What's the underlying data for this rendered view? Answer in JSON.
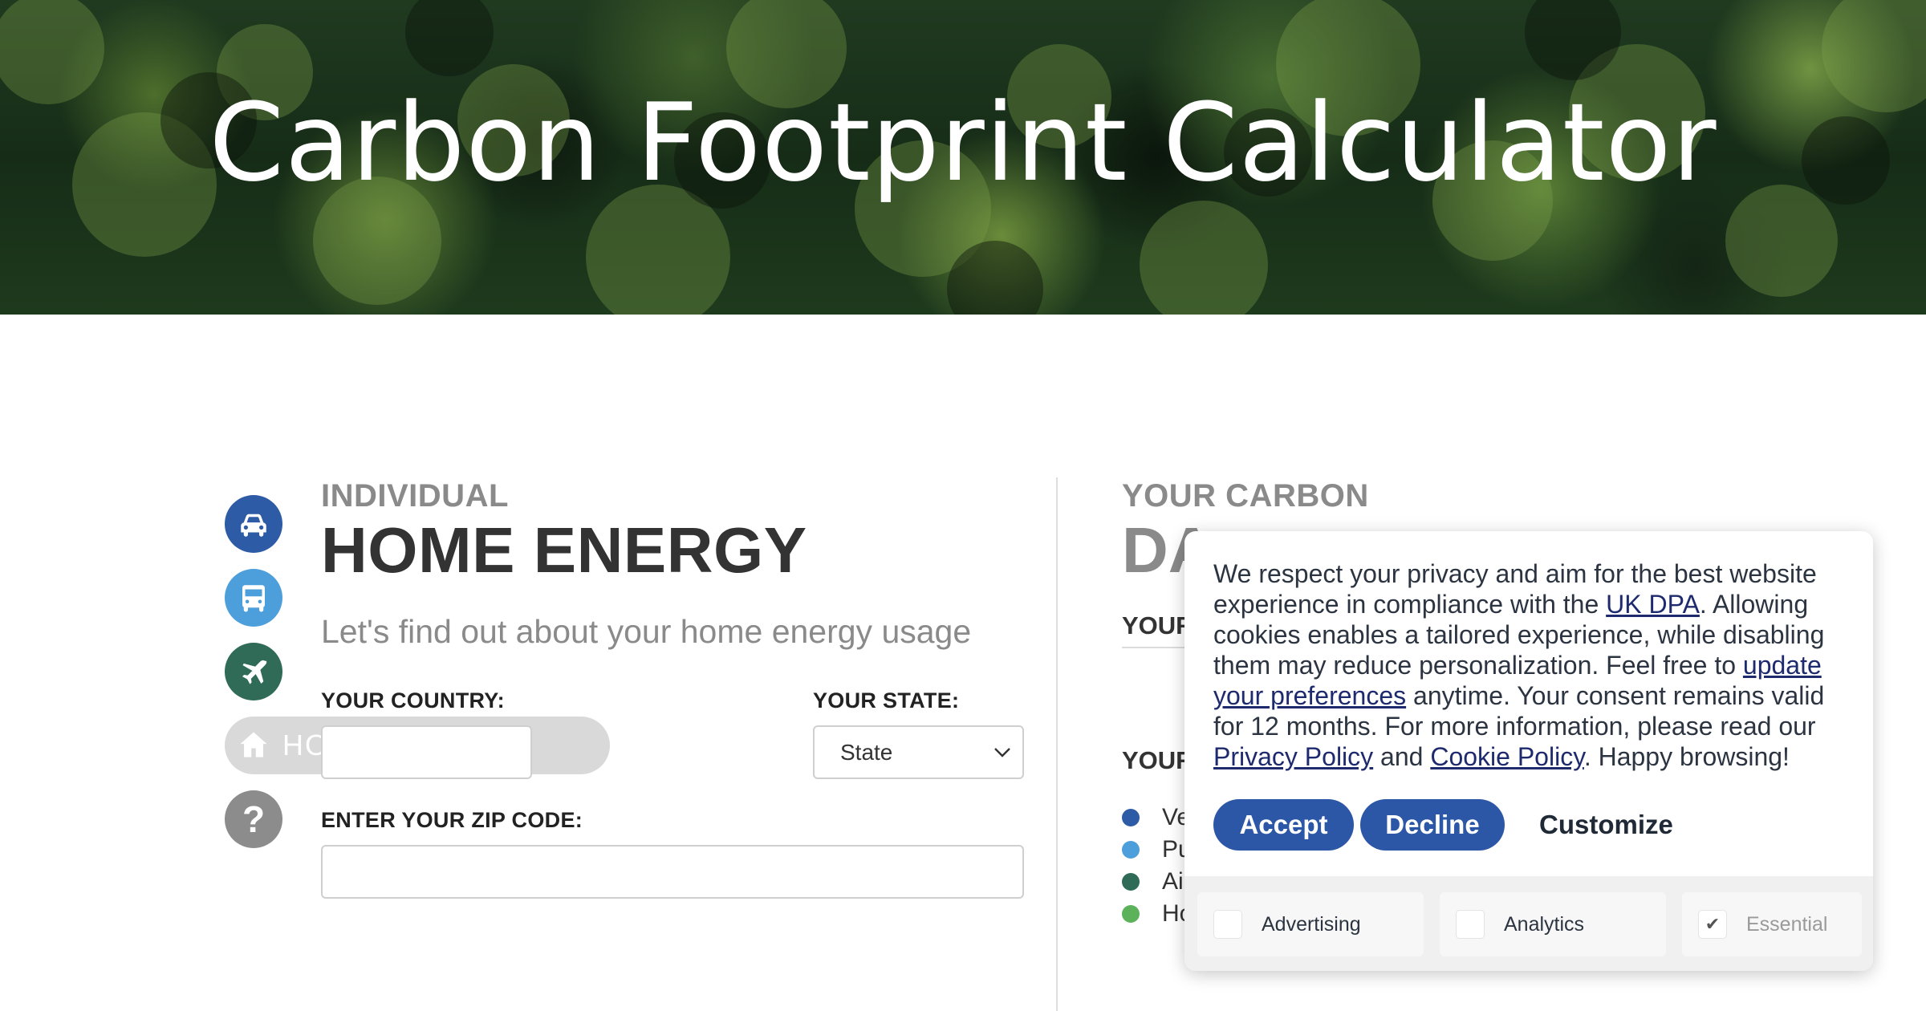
{
  "hero": {
    "title": "Carbon Footprint Calculator"
  },
  "nav": {
    "items": [
      {
        "id": "vehicle",
        "icon": "car-icon",
        "color": "#2d5ba6"
      },
      {
        "id": "public-transport",
        "icon": "bus-icon",
        "color": "#4d9fdc"
      },
      {
        "id": "air",
        "icon": "plane-icon",
        "color": "#2f6b57"
      },
      {
        "id": "home-energy",
        "icon": "house-icon",
        "label": "HOME ENERGY",
        "active": true
      },
      {
        "id": "help",
        "icon": "question-icon",
        "glyph": "?",
        "color": "#8c8c8c"
      }
    ]
  },
  "form": {
    "eyebrow": "INDIVIDUAL",
    "heading": "HOME ENERGY",
    "subtext": "Let's find out about your home energy usage",
    "country_label": "YOUR COUNTRY:",
    "state_label": "YOUR STATE:",
    "state_value": "State",
    "zip_label": "ENTER YOUR ZIP CODE:",
    "zip_value": ""
  },
  "dashboard": {
    "eyebrow": "YOUR CARBON",
    "heading_visible": "DA",
    "sub1": "YOUR",
    "sub2": "YOUR",
    "legend": [
      {
        "text": "Ve",
        "color": "#2d5ba6"
      },
      {
        "text": "Pu",
        "color": "#4d9fdc"
      },
      {
        "text": "Ai",
        "color": "#2f6b57"
      },
      {
        "text": "Ho",
        "color": "#5cb25a"
      }
    ]
  },
  "cookie": {
    "text_1": "We respect your privacy and aim for the best website experience in compliance with the ",
    "link_dpa": "UK DPA",
    "text_2": ". Allowing cookies enables a tailored experience, while disabling them may reduce personalization. Feel free to ",
    "link_prefs": "update your preferences",
    "text_3": " anytime. Your consent remains valid for 12 months. For more information, please read our ",
    "link_privacy": "Privacy Policy",
    "text_4": " and ",
    "link_cookie": "Cookie Policy",
    "text_5": ". Happy browsing!",
    "accept": "Accept",
    "decline": "Decline",
    "customize": "Customize",
    "toggles": [
      {
        "label": "Advertising",
        "checked": false
      },
      {
        "label": "Analytics",
        "checked": false
      },
      {
        "label": "Essential",
        "checked": true,
        "mark": "✔"
      }
    ]
  },
  "colors": {
    "primary_button": "#2b57a6",
    "link": "#1e2a6e"
  }
}
